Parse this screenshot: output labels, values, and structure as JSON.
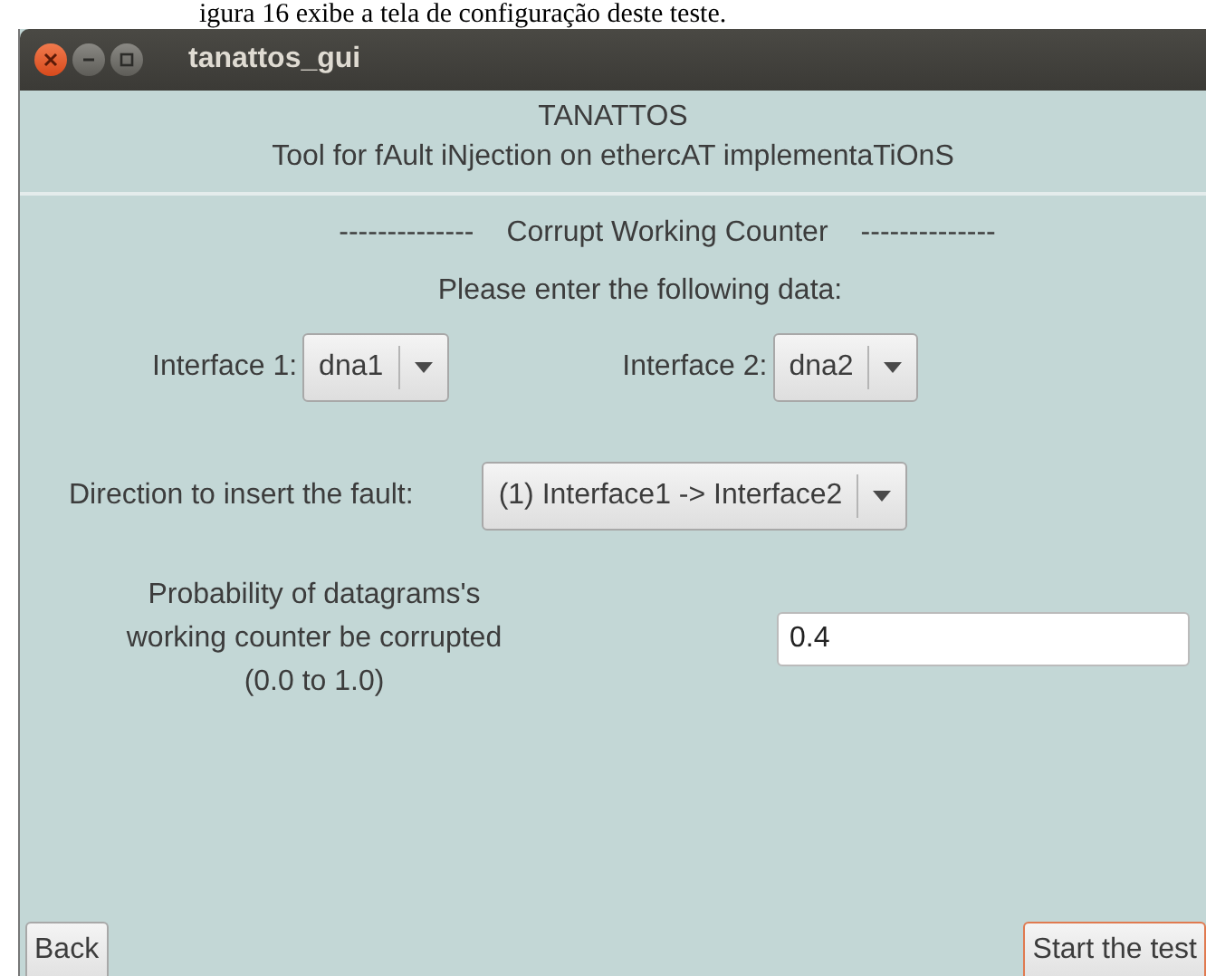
{
  "document_caption": "igura 16 exibe a tela de configuração deste teste.",
  "window": {
    "title": "tanattos_gui"
  },
  "header": {
    "title": "TANATTOS",
    "subtitle": "Tool for fAult iNjection on ethercAT implementaTiOnS"
  },
  "section": {
    "left_rule": "--------------",
    "title": "Corrupt Working Counter",
    "right_rule": "--------------"
  },
  "prompt": "Please enter the following data:",
  "interfaces": [
    {
      "label": "Interface 1:",
      "value": "dna1"
    },
    {
      "label": "Interface 2:",
      "value": "dna2"
    }
  ],
  "direction": {
    "label": "Direction to insert the fault:",
    "value": "(1) Interface1 -> Interface2"
  },
  "probability": {
    "label": "Probability of datagrams's working counter be corrupted (0.0 to 1.0)",
    "value": "0.4"
  },
  "buttons": [
    {
      "label": "Back",
      "kind": "plain"
    },
    {
      "label": "Start the test",
      "kind": "default"
    }
  ]
}
